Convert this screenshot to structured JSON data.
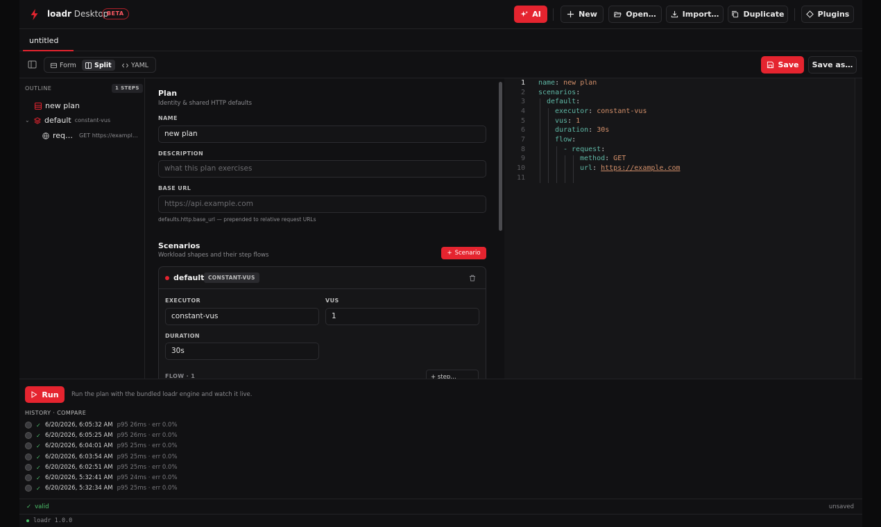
{
  "app": {
    "brand": "loadr",
    "brand_suffix": "Desktop",
    "beta": "BETA",
    "accent": "#e5242f"
  },
  "topbar": {
    "ai": "AI",
    "new": "New",
    "open": "Open…",
    "import": "Import…",
    "duplicate": "Duplicate",
    "plugins": "Plugins"
  },
  "tab": {
    "title": "untitled"
  },
  "toolbar": {
    "form": "Form",
    "split": "Split",
    "yaml": "YAML",
    "save": "Save",
    "save_as": "Save as…"
  },
  "outline": {
    "heading": "OUTLINE",
    "steps_badge": "1 STEPS",
    "plan": "new plan",
    "scenario": "default",
    "scenario_kind": "constant-vus",
    "request": "req…",
    "request_detail": "GET https://exampl…"
  },
  "form": {
    "plan_title": "Plan",
    "plan_sub": "Identity & shared HTTP defaults",
    "name_label": "NAME",
    "name_value": "new plan",
    "desc_label": "DESCRIPTION",
    "desc_placeholder": "what this plan exercises",
    "base_label": "BASE URL",
    "base_placeholder": "https://api.example.com",
    "base_hint": "defaults.http.base_url — prepended to relative request URLs",
    "scen_title": "Scenarios",
    "scen_sub": "Workload shapes and their step flows",
    "add_scenario": "Scenario",
    "card": {
      "name": "default",
      "badge": "CONSTANT-VUS",
      "executor_label": "EXECUTOR",
      "executor_value": "constant-vus",
      "vus_label": "VUS",
      "vus_value": "1",
      "duration_label": "DURATION",
      "duration_value": "30s",
      "flow_label": "FLOW · 1",
      "step_btn": "+ step…"
    }
  },
  "yaml": {
    "line_numbers": [
      "1",
      "2",
      "3",
      "4",
      "5",
      "6",
      "7",
      "8",
      "9",
      "10",
      "11"
    ],
    "lines": [
      {
        "k": "name",
        "v": "new plan"
      },
      {
        "k": "scenarios",
        "v": ""
      },
      {
        "k": "default",
        "v": ""
      },
      {
        "k": "executor",
        "v": "constant-vus"
      },
      {
        "k": "vus",
        "v": "1"
      },
      {
        "k": "duration",
        "v": "30s"
      },
      {
        "k": "flow",
        "v": ""
      },
      {
        "k": "- request",
        "v": ""
      },
      {
        "k": "method",
        "v": "GET"
      },
      {
        "k": "url",
        "v": "https://example.com"
      }
    ]
  },
  "run": {
    "button": "Run",
    "description": "Run the plan with the bundled loadr engine and watch it live.",
    "history_heading": "HISTORY · COMPARE",
    "history": [
      {
        "time": "6/20/2026, 6:05:32 AM",
        "stats": "p95 26ms · err 0.0%"
      },
      {
        "time": "6/20/2026, 6:05:25 AM",
        "stats": "p95 26ms · err 0.0%"
      },
      {
        "time": "6/20/2026, 6:04:01 AM",
        "stats": "p95 25ms · err 0.0%"
      },
      {
        "time": "6/20/2026, 6:03:54 AM",
        "stats": "p95 25ms · err 0.0%"
      },
      {
        "time": "6/20/2026, 6:02:51 AM",
        "stats": "p95 25ms · err 0.0%"
      },
      {
        "time": "6/20/2026, 5:32:41 AM",
        "stats": "p95 24ms · err 0.0%"
      },
      {
        "time": "6/20/2026, 5:32:34 AM",
        "stats": "p95 25ms · err 0.0%"
      }
    ]
  },
  "status": {
    "valid": "valid",
    "unsaved": "unsaved",
    "version": "loadr 1.0.0"
  }
}
